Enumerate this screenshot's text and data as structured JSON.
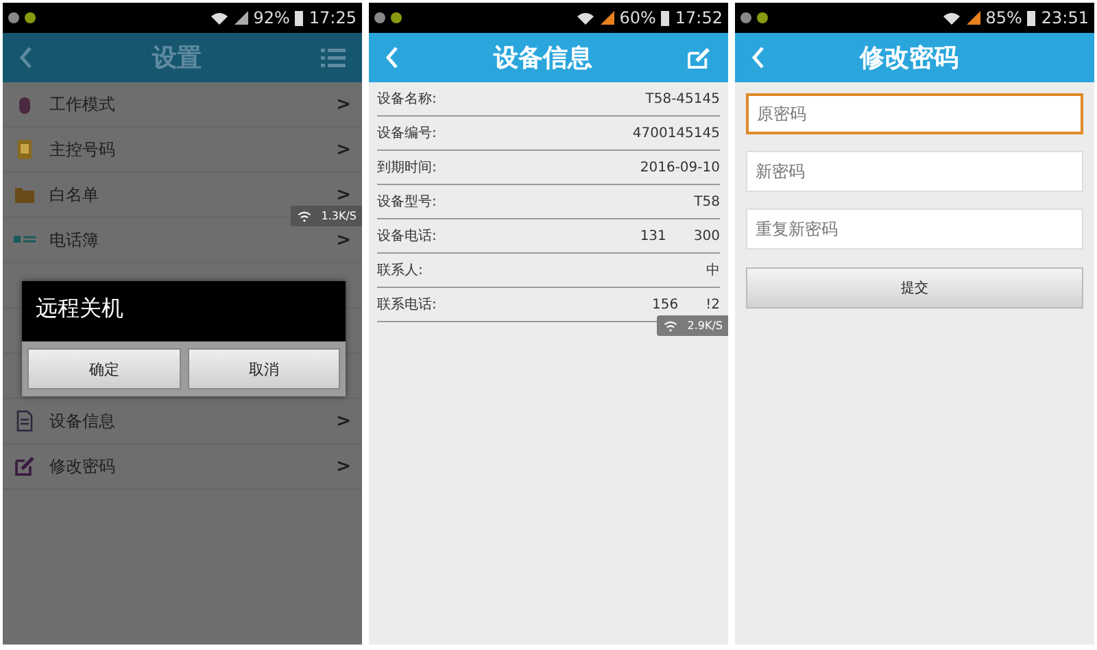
{
  "screens": [
    {
      "kind": "settings",
      "status_bar": {
        "battery": "92%",
        "time": "17:25"
      },
      "title": "设置",
      "menu": [
        {
          "label": "工作模式",
          "kind": "mouse"
        },
        {
          "label": "主控号码",
          "kind": "phone"
        },
        {
          "label": "白名单",
          "kind": "folder"
        },
        {
          "label": "电话簿",
          "kind": "contacts"
        },
        {
          "kind": "covered"
        },
        {
          "kind": "covered"
        },
        {
          "kind": "covered"
        },
        {
          "label": "设备信息",
          "kind": "document"
        },
        {
          "label": "修改密码",
          "kind": "edit"
        }
      ],
      "arrow": ">",
      "speed": "1.3K/S",
      "dialog": {
        "title": "远程关机",
        "buttons": [
          "确定",
          "取消"
        ]
      }
    },
    {
      "kind": "info",
      "status_bar": {
        "battery": "60%",
        "time": "17:52"
      },
      "title": "设备信息",
      "rows": [
        {
          "label": "设备名称:",
          "values": [
            "T58-45145"
          ]
        },
        {
          "label": "设备编号:",
          "values": [
            "4700145145"
          ]
        },
        {
          "label": "到期时间:",
          "values": [
            "2016-09-10"
          ]
        },
        {
          "label": "设备型号:",
          "values": [
            "T58"
          ]
        },
        {
          "label": "设备电话:",
          "values": [
            "131",
            "300"
          ]
        },
        {
          "label": "联系人:",
          "values": [
            "中"
          ]
        },
        {
          "label": "联系电话:",
          "values": [
            "156",
            "!2"
          ]
        }
      ],
      "speed": "2.9K/S"
    },
    {
      "kind": "password",
      "status_bar": {
        "battery": "85%",
        "time": "23:51"
      },
      "title": "修改密码",
      "fields": [
        {
          "placeholder": "原密码",
          "focused": true
        },
        {
          "placeholder": "新密码",
          "focused": false
        },
        {
          "placeholder": "重复新密码",
          "focused": false
        }
      ],
      "submit": "提交"
    }
  ]
}
